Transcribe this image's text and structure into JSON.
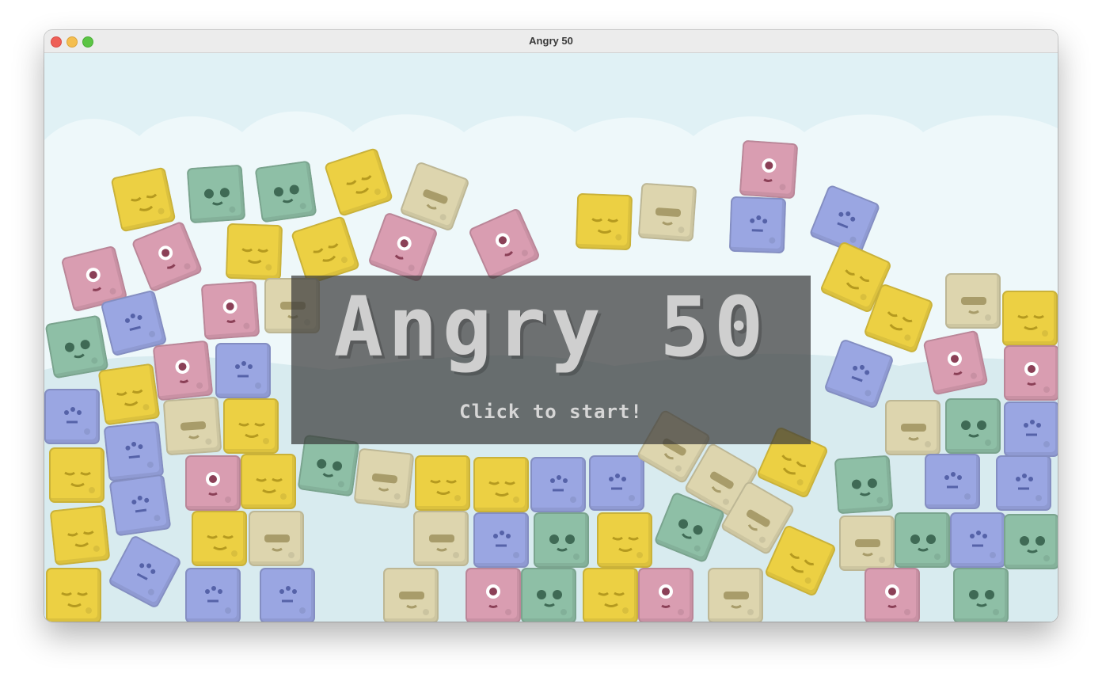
{
  "window": {
    "title": "Angry 50"
  },
  "game": {
    "title": "Angry 50",
    "prompt": "Click to start!"
  },
  "colors": {
    "sky": "#eaf5f8",
    "clouds": "#f6fbfc",
    "hills": "#d8ebef",
    "yellow": "#ecd043",
    "teal": "#8ebfa6",
    "pink": "#d99db1",
    "blue": "#9aa6e2",
    "tan": "#ddd5ae"
  },
  "block_types": [
    "yellow-sleepy-face",
    "teal-round-eyes-face",
    "pink-cyclops-face",
    "blue-spotted-face",
    "tan-bar-face"
  ]
}
